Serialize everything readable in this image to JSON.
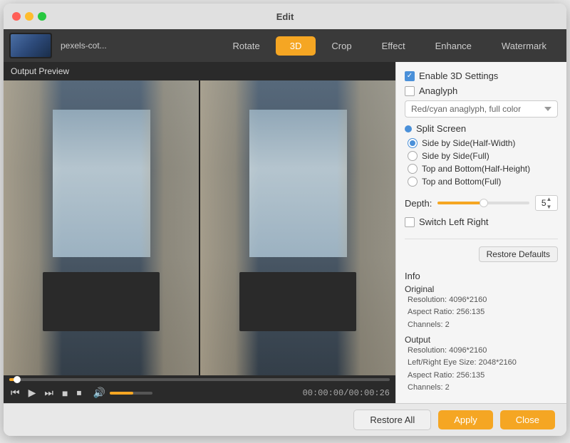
{
  "window": {
    "title": "Edit"
  },
  "toolbar": {
    "file_name": "pexels-cot...",
    "tabs": [
      {
        "id": "rotate",
        "label": "Rotate",
        "active": false
      },
      {
        "id": "3d",
        "label": "3D",
        "active": true
      },
      {
        "id": "crop",
        "label": "Crop",
        "active": false
      },
      {
        "id": "effect",
        "label": "Effect",
        "active": false
      },
      {
        "id": "enhance",
        "label": "Enhance",
        "active": false
      },
      {
        "id": "watermark",
        "label": "Watermark",
        "active": false
      }
    ]
  },
  "preview": {
    "label": "Output Preview"
  },
  "controls": {
    "time_current": "00:00:00",
    "time_total": "00:00:26",
    "time_display": "00:00:00/00:00:26"
  },
  "settings": {
    "enable_3d_label": "Enable 3D Settings",
    "anaglyph_label": "Anaglyph",
    "anaglyph_option": "Red/cyan anaglyph, full color",
    "split_screen_label": "Split Screen",
    "options": [
      {
        "id": "side_by_side_half",
        "label": "Side by Side(Half-Width)",
        "selected": true
      },
      {
        "id": "side_by_side_full",
        "label": "Side by Side(Full)",
        "selected": false
      },
      {
        "id": "top_bottom_half",
        "label": "Top and Bottom(Half-Height)",
        "selected": false
      },
      {
        "id": "top_bottom_full",
        "label": "Top and Bottom(Full)",
        "selected": false
      }
    ],
    "depth_label": "Depth:",
    "depth_value": "5",
    "switch_lr_label": "Switch Left Right",
    "restore_defaults_label": "Restore Defaults"
  },
  "info": {
    "title": "Info",
    "original_label": "Original",
    "original_resolution": "Resolution: 4096*2160",
    "original_aspect": "Aspect Ratio: 256:135",
    "original_channels": "Channels: 2",
    "output_label": "Output",
    "output_resolution": "Resolution: 4096*2160",
    "output_eye_size": "Left/Right Eye Size: 2048*2160",
    "output_aspect": "Aspect Ratio: 256:135",
    "output_channels": "Channels: 2"
  },
  "bottom_bar": {
    "restore_all_label": "Restore All",
    "apply_label": "Apply",
    "close_label": "Close"
  },
  "colors": {
    "accent": "#f5a623",
    "active_tab": "#f5a623",
    "checkbox_checked": "#4a90d9",
    "radio_selected": "#4a90d9"
  }
}
